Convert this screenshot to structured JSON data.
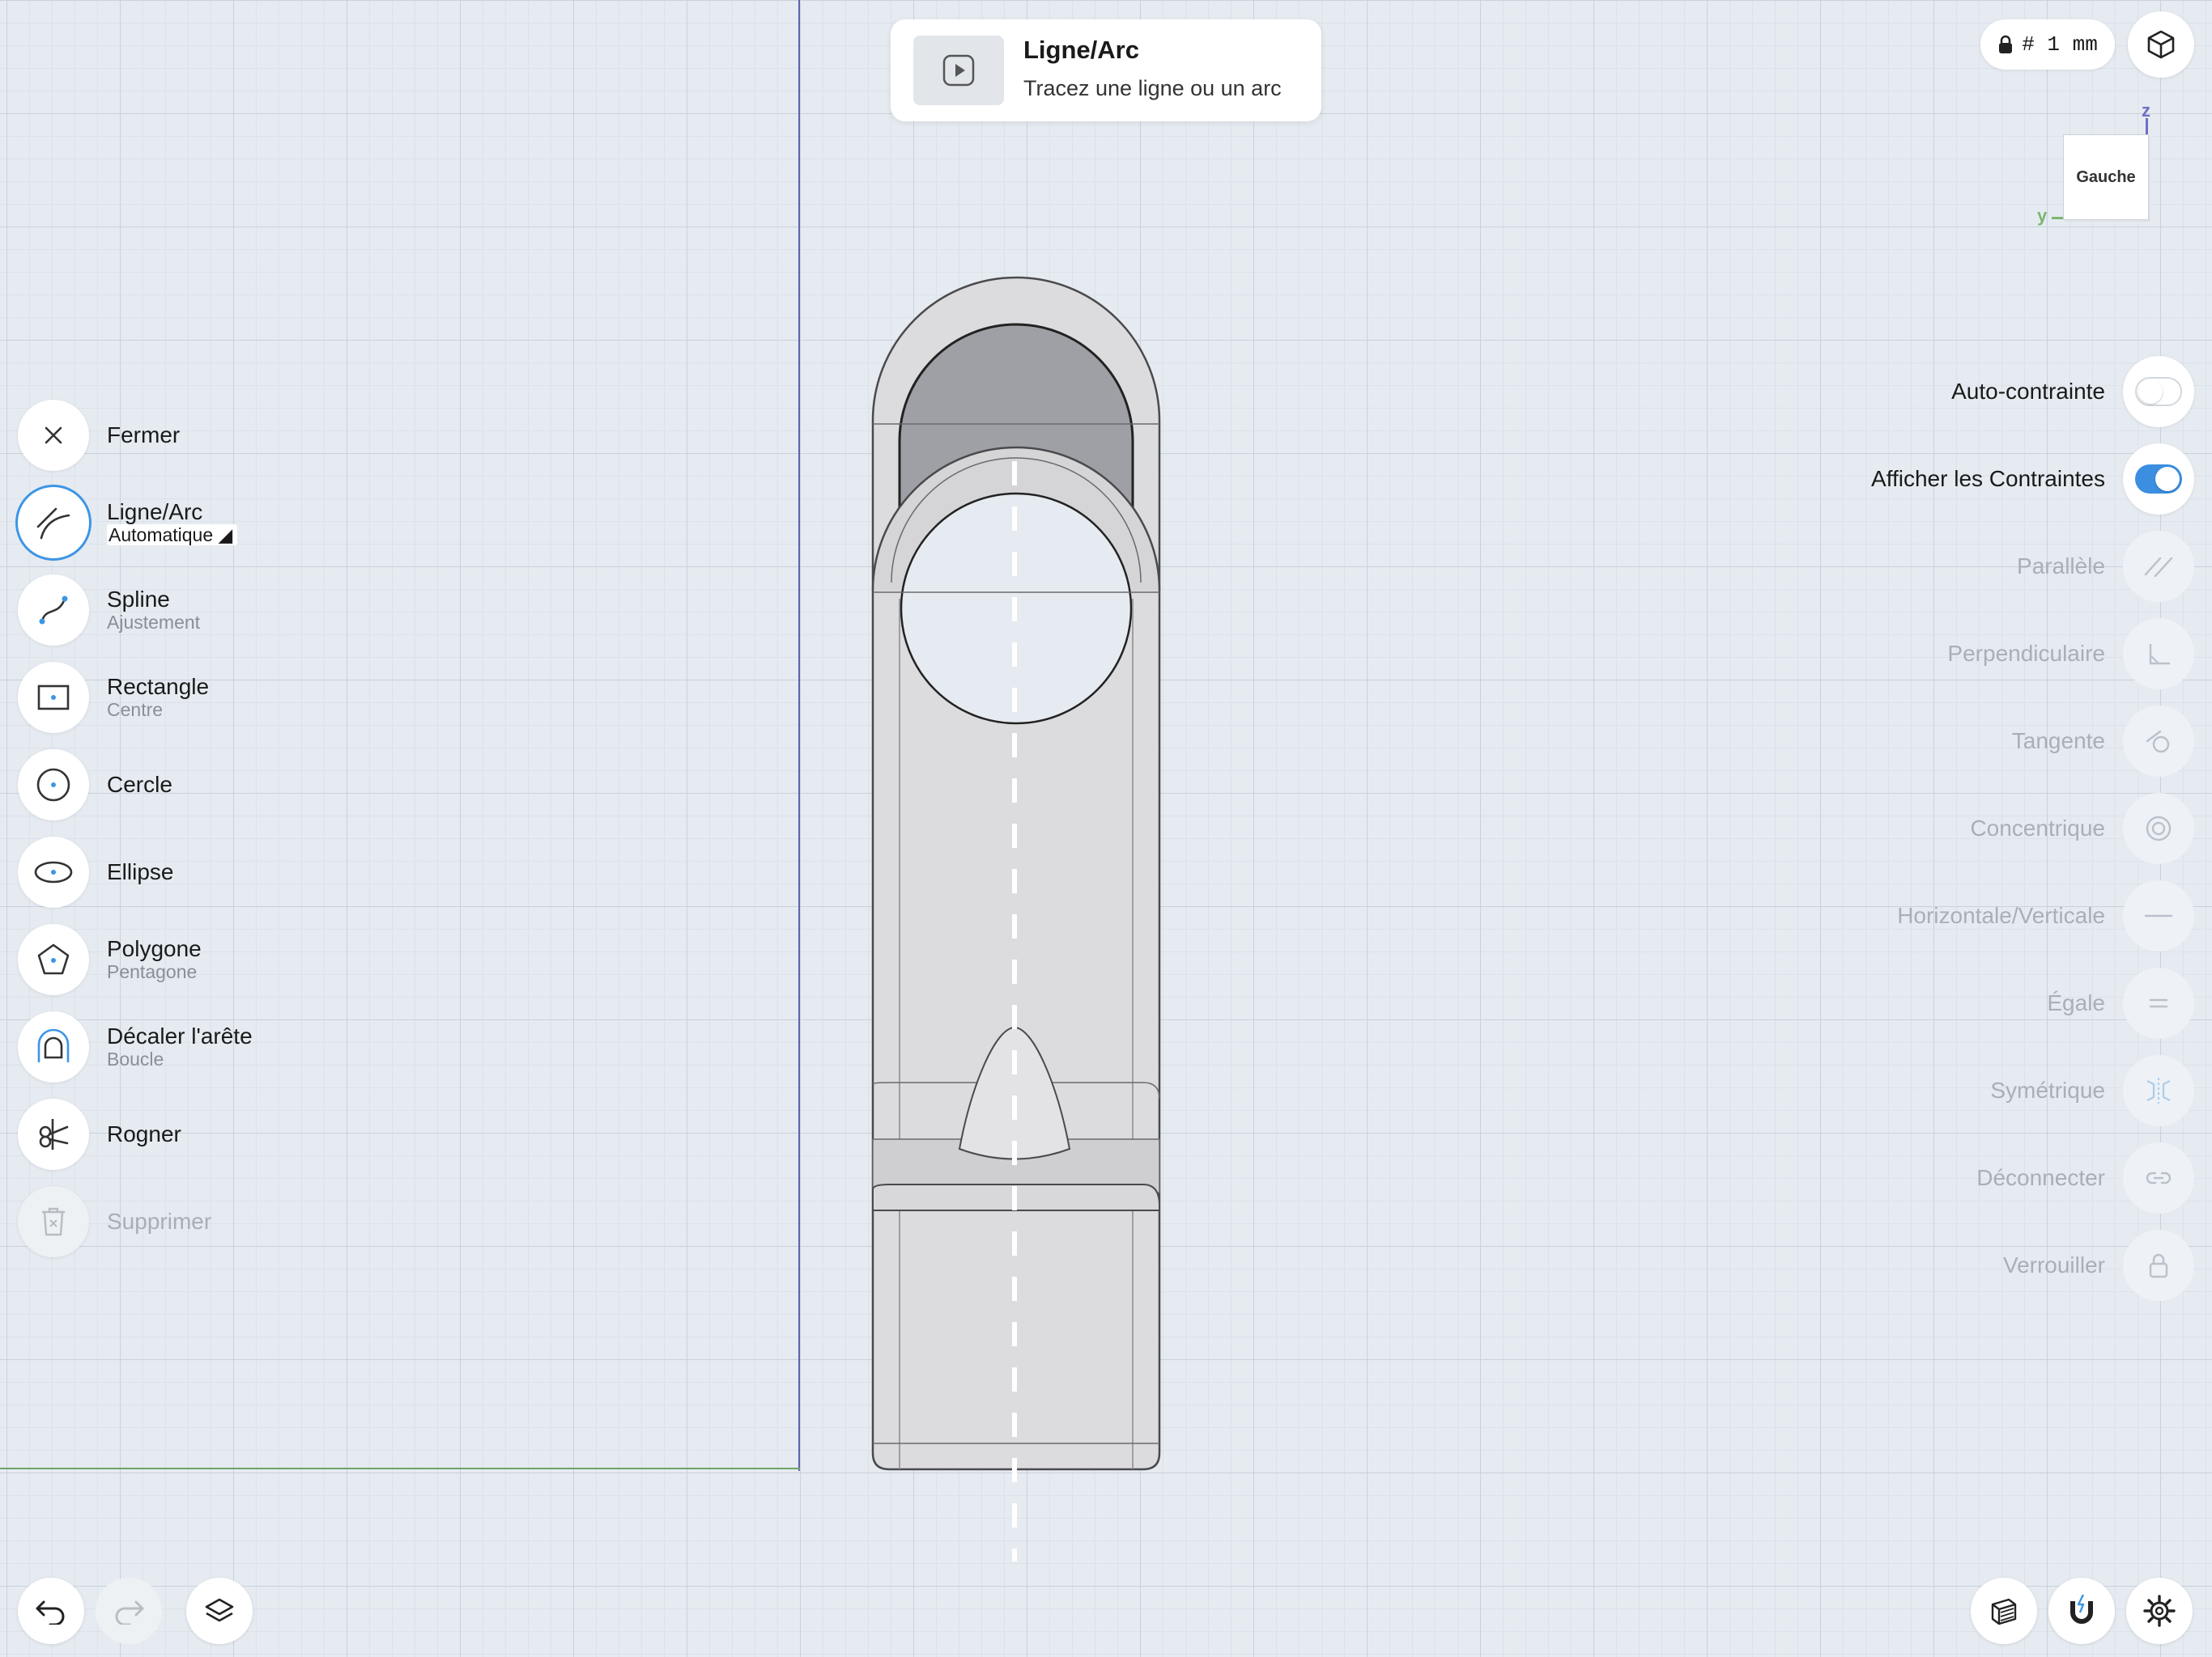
{
  "tooltip": {
    "title": "Ligne/Arc",
    "description": "Tracez une ligne ou un arc"
  },
  "grid": {
    "label": "# 1 mm"
  },
  "view_cube": {
    "face": "Gauche",
    "axis_z": "z",
    "axis_y": "y"
  },
  "tools": [
    {
      "label": "Fermer",
      "sub": "",
      "icon": "close-icon"
    },
    {
      "label": "Ligne/Arc",
      "sub": "Automatique ◢",
      "icon": "line-arc-icon",
      "active": true
    },
    {
      "label": "Spline",
      "sub": "Ajustement",
      "icon": "spline-icon"
    },
    {
      "label": "Rectangle",
      "sub": "Centre",
      "icon": "rectangle-icon"
    },
    {
      "label": "Cercle",
      "sub": "",
      "icon": "circle-icon"
    },
    {
      "label": "Ellipse",
      "sub": "",
      "icon": "ellipse-icon"
    },
    {
      "label": "Polygone",
      "sub": "Pentagone",
      "icon": "polygon-icon"
    },
    {
      "label": "Décaler l'arête",
      "sub": "Boucle",
      "icon": "offset-edge-icon"
    },
    {
      "label": "Rogner",
      "sub": "",
      "icon": "trim-icon"
    },
    {
      "label": "Supprimer",
      "sub": "",
      "icon": "trash-icon",
      "disabled": true
    }
  ],
  "constraints": [
    {
      "label": "Auto-contrainte",
      "type": "toggle",
      "on": false
    },
    {
      "label": "Afficher les Contraintes",
      "type": "toggle",
      "on": true
    },
    {
      "label": "Parallèle",
      "icon": "parallel-icon"
    },
    {
      "label": "Perpendiculaire",
      "icon": "perpendicular-icon"
    },
    {
      "label": "Tangente",
      "icon": "tangent-icon"
    },
    {
      "label": "Concentrique",
      "icon": "concentric-icon"
    },
    {
      "label": "Horizontale/Verticale",
      "icon": "horizontal-vertical-icon"
    },
    {
      "label": "Égale",
      "icon": "equal-icon"
    },
    {
      "label": "Symétrique",
      "icon": "symmetric-icon"
    },
    {
      "label": "Déconnecter",
      "icon": "disconnect-icon"
    },
    {
      "label": "Verrouiller",
      "icon": "lock-icon"
    }
  ],
  "colors": {
    "accent": "#3b8ee0",
    "axis_vertical": "#5c62b0",
    "axis_horizontal": "#6ea36a"
  }
}
